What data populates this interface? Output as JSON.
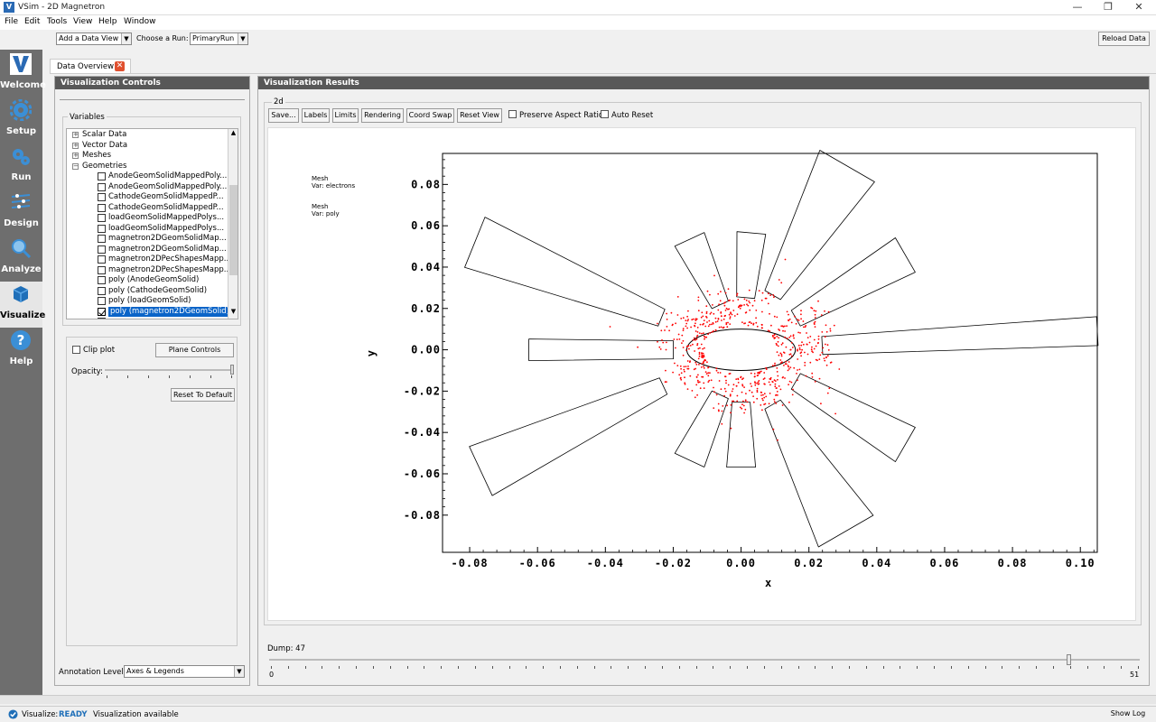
{
  "window": {
    "title": "VSim - 2D Magnetron",
    "minimize": "—",
    "restore": "❐",
    "close": "✕"
  },
  "menu": [
    "File",
    "Edit",
    "Tools",
    "View",
    "Help",
    "Window"
  ],
  "toolbar": {
    "add_view_value": "Add a Data View",
    "choose_run_label": "Choose a Run:",
    "choose_run_value": "PrimaryRun",
    "reload_label": "Reload Data"
  },
  "sidebar": [
    {
      "label": "Welcome",
      "icon": "welcome-icon"
    },
    {
      "label": "Setup",
      "icon": "gear-icon"
    },
    {
      "label": "Run",
      "icon": "run-gears-icon"
    },
    {
      "label": "Design",
      "icon": "design-icon"
    },
    {
      "label": "Analyze",
      "icon": "magnifier-icon"
    },
    {
      "label": "Visualize",
      "icon": "cube-icon"
    },
    {
      "label": "Help",
      "icon": "help-icon"
    }
  ],
  "tab": {
    "label": "Data Overview1"
  },
  "controls": {
    "title": "Visualization Controls",
    "variables_label": "Variables",
    "tree": [
      {
        "label": "Scalar Data",
        "kind": "group"
      },
      {
        "label": "Vector Data",
        "kind": "group"
      },
      {
        "label": "Meshes",
        "kind": "group"
      },
      {
        "label": "Geometries",
        "kind": "group-open"
      },
      {
        "label": "AnodeGeomSolidMappedPoly...",
        "kind": "item"
      },
      {
        "label": "AnodeGeomSolidMappedPoly...",
        "kind": "item"
      },
      {
        "label": "CathodeGeomSolidMappedP...",
        "kind": "item"
      },
      {
        "label": "CathodeGeomSolidMappedP...",
        "kind": "item"
      },
      {
        "label": "loadGeomSolidMappedPolys...",
        "kind": "item"
      },
      {
        "label": "loadGeomSolidMappedPolys...",
        "kind": "item"
      },
      {
        "label": "magnetron2DGeomSolidMap...",
        "kind": "item"
      },
      {
        "label": "magnetron2DGeomSolidMap...",
        "kind": "item"
      },
      {
        "label": "magnetron2DPecShapesMapp...",
        "kind": "item"
      },
      {
        "label": "magnetron2DPecShapesMapp...",
        "kind": "item"
      },
      {
        "label": "poly (AnodeGeomSolid)",
        "kind": "item"
      },
      {
        "label": "poly (CathodeGeomSolid)",
        "kind": "item"
      },
      {
        "label": "poly (loadGeomSolid)",
        "kind": "item"
      },
      {
        "label": "poly (magnetron2DGeomSolid)",
        "kind": "item-selected"
      }
    ],
    "clip_plot_label": "Clip plot",
    "plane_controls_label": "Plane Controls",
    "opacity_label": "Opacity:",
    "reset_default_label": "Reset To Default",
    "annotation_label": "Annotation Level:",
    "annotation_value": "Axes & Legends"
  },
  "results": {
    "title": "Visualization Results",
    "group_label": "2d",
    "buttons": [
      "Save...",
      "Labels",
      "Limits",
      "Rendering",
      "Coord Swap",
      "Reset View"
    ],
    "preserve_aspect_label": "Preserve Aspect Ratio",
    "auto_reset_label": "Auto Reset",
    "legend": [
      {
        "line1": "Mesh",
        "line2": "Var: electrons"
      },
      {
        "line1": "Mesh",
        "line2": "Var: poly"
      }
    ],
    "dump_label": "Dump: 47",
    "dump_min": "0",
    "dump_max": "51",
    "dump_value": 47,
    "dump_total": 51
  },
  "chart_data": {
    "type": "scatter",
    "title": "",
    "xlabel": "x",
    "ylabel": "y",
    "xlim": [
      -0.088,
      0.105
    ],
    "ylim": [
      -0.098,
      0.095
    ],
    "xticks": [
      "-0.08",
      "-0.06",
      "-0.04",
      "-0.02",
      "0.00",
      "0.02",
      "0.04",
      "0.06",
      "0.08",
      "0.10"
    ],
    "yticks": [
      "0.08",
      "0.06",
      "0.04",
      "0.02",
      "0.00",
      "-0.02",
      "-0.04",
      "-0.06",
      "-0.08"
    ],
    "series": [
      {
        "name": "electrons",
        "color": "#ff0000"
      },
      {
        "name": "poly",
        "color": "#000000"
      }
    ],
    "cathode_radius": 0.01
  },
  "status": {
    "label": "Visualize:",
    "state": "READY",
    "message": "Visualization available",
    "show_log_label": "Show Log"
  }
}
